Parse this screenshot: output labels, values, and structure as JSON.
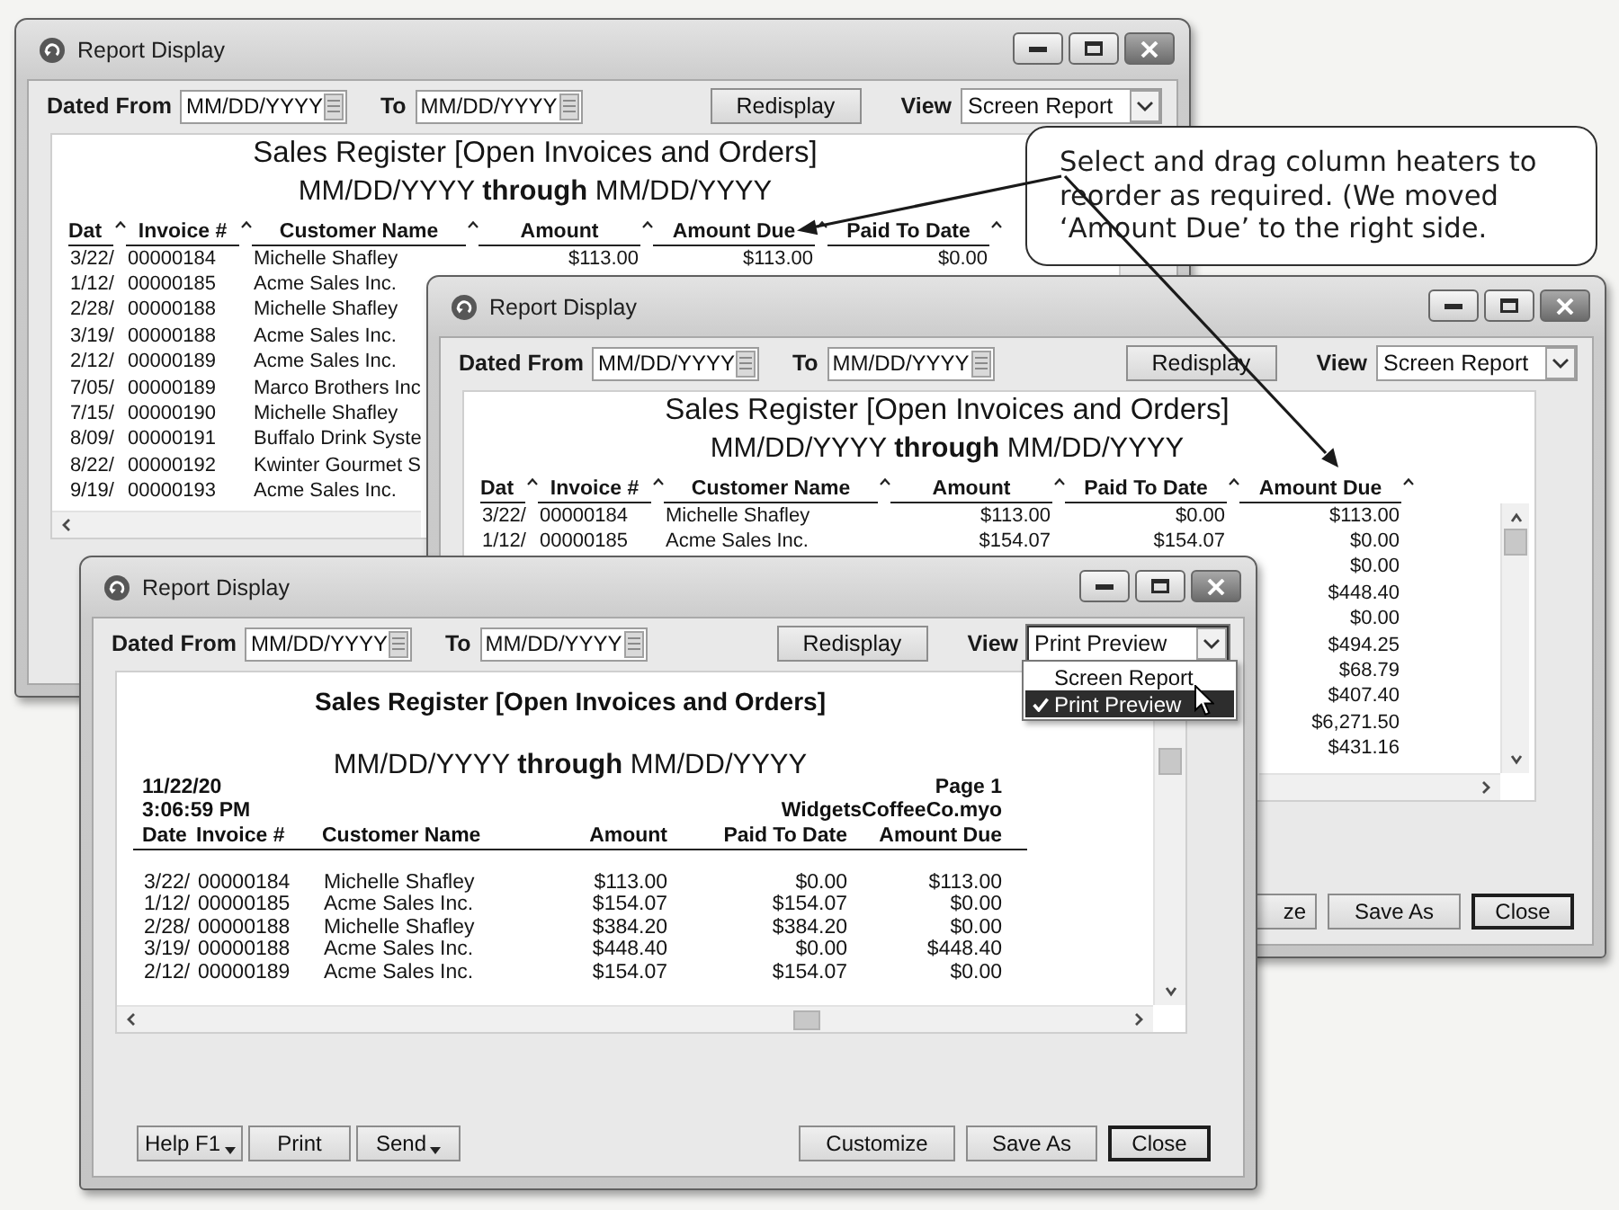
{
  "windows": [
    {
      "title": "Report Display",
      "dated_from": {
        "label": "Dated From",
        "value": "MM/DD/YYYY"
      },
      "to": {
        "label": "To",
        "value": "MM/DD/YYYY"
      },
      "redisplay": "Redisplay",
      "view": {
        "label": "View",
        "value": "Screen Report",
        "expanded": false
      },
      "report": {
        "kind": "screen",
        "title": "Sales Register [Open Invoices and Orders]",
        "range": "MM/DD/YYYY **through** MM/DD/YYYY",
        "columns": [
          {
            "kind": "date",
            "label": "Dat"
          },
          {
            "kind": "invoice_no",
            "label": "Invoice #"
          },
          {
            "kind": "customer_name",
            "label": "Customer Name"
          },
          {
            "kind": "amount",
            "label": "Amount"
          },
          {
            "kind": "amount_due",
            "label": "Amount Due"
          },
          {
            "kind": "paid_to_date",
            "label": "Paid To Date"
          }
        ],
        "rows": [
          {
            "date": "3/22/",
            "invoice_no": "00000184",
            "customer_name": "Michelle Shafley",
            "amount": "$113.00",
            "amount_due": "$113.00",
            "paid_to_date": "$0.00"
          },
          {
            "date": "1/12/",
            "invoice_no": "00000185",
            "customer_name": "Acme Sales Inc."
          },
          {
            "date": "2/28/",
            "invoice_no": "00000188",
            "customer_name": "Michelle Shafley"
          },
          {
            "date": "3/19/",
            "invoice_no": "00000188",
            "customer_name": "Acme Sales Inc."
          },
          {
            "date": "2/12/",
            "invoice_no": "00000189",
            "customer_name": "Acme Sales Inc."
          },
          {
            "date": "7/05/",
            "invoice_no": "00000189",
            "customer_name": "Marco Brothers Inc"
          },
          {
            "date": "7/15/",
            "invoice_no": "00000190",
            "customer_name": "Michelle Shafley"
          },
          {
            "date": "8/09/",
            "invoice_no": "00000191",
            "customer_name": "Buffalo Drink Syste"
          },
          {
            "date": "8/22/",
            "invoice_no": "00000192",
            "customer_name": "Kwinter Gourmet S"
          },
          {
            "date": "9/19/",
            "invoice_no": "00000193",
            "customer_name": "Acme Sales Inc."
          }
        ]
      }
    },
    {
      "title": "Report Display",
      "dated_from": {
        "label": "Dated From",
        "value": "MM/DD/YYYY"
      },
      "to": {
        "label": "To",
        "value": "MM/DD/YYYY"
      },
      "redisplay": "Redisplay",
      "view": {
        "label": "View",
        "value": "Screen Report",
        "expanded": false
      },
      "report": {
        "kind": "screen",
        "title": "Sales Register [Open Invoices and Orders]",
        "range": "MM/DD/YYYY **through** MM/DD/YYYY",
        "columns": [
          {
            "kind": "date",
            "label": "Dat"
          },
          {
            "kind": "invoice_no",
            "label": "Invoice #"
          },
          {
            "kind": "customer_name",
            "label": "Customer Name"
          },
          {
            "kind": "amount",
            "label": "Amount"
          },
          {
            "kind": "paid_to_date",
            "label": "Paid To Date"
          },
          {
            "kind": "amount_due",
            "label": "Amount Due"
          }
        ],
        "rows": [
          {
            "date": "3/22/",
            "invoice_no": "00000184",
            "customer_name": "Michelle Shafley",
            "amount": "$113.00",
            "paid_to_date": "$0.00",
            "amount_due": "$113.00"
          },
          {
            "date": "1/12/",
            "invoice_no": "00000185",
            "customer_name": "Acme Sales Inc.",
            "amount": "$154.07",
            "paid_to_date": "$154.07",
            "amount_due": "$0.00"
          },
          {
            "amount_due": "$0.00"
          },
          {
            "amount_due": "$448.40"
          },
          {
            "amount_due": "$0.00"
          },
          {
            "amount_due": "$494.25"
          },
          {
            "amount_due": "$68.79"
          },
          {
            "amount_due": "$407.40"
          },
          {
            "amount_due": "$6,271.50"
          },
          {
            "amount_due": "$431.16"
          }
        ]
      },
      "buttons_right": [
        {
          "label": "ze",
          "default": false,
          "clipped": true
        },
        {
          "label": "Save As",
          "default": false,
          "clipped": false
        },
        {
          "label": "Close",
          "default": true,
          "clipped": false
        }
      ]
    },
    {
      "title": "Report Display",
      "dated_from": {
        "label": "Dated From",
        "value": "MM/DD/YYYY"
      },
      "to": {
        "label": "To",
        "value": "MM/DD/YYYY"
      },
      "redisplay": "Redisplay",
      "view": {
        "label": "View",
        "value": "Print Preview",
        "expanded": true,
        "options": [
          {
            "label": "Screen Report",
            "selected": false
          },
          {
            "label": "Print Preview",
            "selected": true
          }
        ]
      },
      "report": {
        "kind": "print_preview",
        "title": "Sales Register [Open Invoices and Orders]",
        "range": "MM/DD/YYYY **through** MM/DD/YYYY",
        "print_date": "11/22/20",
        "print_time": "3:06:59 PM",
        "page": "Page 1",
        "file_name": "WidgetsCoffeeCo.myo",
        "columns": [
          {
            "kind": "date",
            "label": "Date"
          },
          {
            "kind": "invoice_no",
            "label": "Invoice #"
          },
          {
            "kind": "customer_name",
            "label": "Customer Name"
          },
          {
            "kind": "amount",
            "label": "Amount"
          },
          {
            "kind": "paid_to_date",
            "label": "Paid To Date"
          },
          {
            "kind": "amount_due",
            "label": "Amount Due"
          }
        ],
        "rows": [
          {
            "date": "3/22/",
            "invoice_no": "00000184",
            "customer_name": "Michelle Shafley",
            "amount": "$113.00",
            "paid_to_date": "$0.00",
            "amount_due": "$113.00"
          },
          {
            "date": "1/12/",
            "invoice_no": "00000185",
            "customer_name": "Acme Sales Inc.",
            "amount": "$154.07",
            "paid_to_date": "$154.07",
            "amount_due": "$0.00"
          },
          {
            "date": "2/28/",
            "invoice_no": "00000188",
            "customer_name": "Michelle Shafley",
            "amount": "$384.20",
            "paid_to_date": "$384.20",
            "amount_due": "$0.00"
          },
          {
            "date": "3/19/",
            "invoice_no": "00000188",
            "customer_name": "Acme Sales Inc.",
            "amount": "$448.40",
            "paid_to_date": "$0.00",
            "amount_due": "$448.40"
          },
          {
            "date": "2/12/",
            "invoice_no": "00000189",
            "customer_name": "Acme Sales Inc.",
            "amount": "$154.07",
            "paid_to_date": "$154.07",
            "amount_due": "$0.00"
          }
        ]
      },
      "buttons_left": [
        {
          "label": "Help F1",
          "menu": true
        },
        {
          "label": "Print",
          "menu": false
        },
        {
          "label": "Send",
          "menu": true
        }
      ],
      "buttons_right": [
        {
          "label": "Customize",
          "default": false,
          "clipped": false
        },
        {
          "label": "Save As",
          "default": false,
          "clipped": false
        },
        {
          "label": "Close",
          "default": true,
          "clipped": false
        }
      ]
    }
  ],
  "callout": {
    "text": "Select and drag column heaters to reorder as required. (We moved ‘Amount Due’ to the right side."
  }
}
